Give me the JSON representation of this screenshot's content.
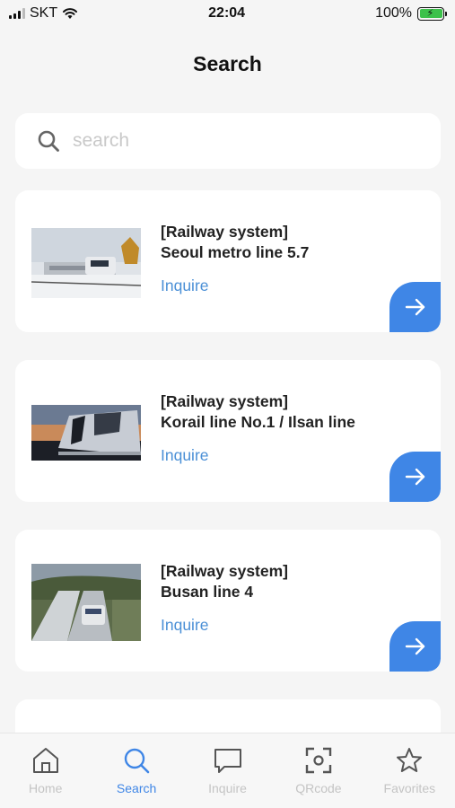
{
  "status_bar": {
    "carrier": "SKT",
    "time": "22:04",
    "battery": "100%"
  },
  "header": {
    "title": "Search"
  },
  "search": {
    "placeholder": "search",
    "value": ""
  },
  "cards": [
    {
      "tag": "[Railway system]",
      "name": "Seoul metro line 5.7",
      "action": "Inquire"
    },
    {
      "tag": "[Railway system]",
      "name": "Korail line No.1 / Ilsan line",
      "action": "Inquire"
    },
    {
      "tag": "[Railway system]",
      "name": "Busan line 4",
      "action": "Inquire"
    }
  ],
  "tab_bar": {
    "items": [
      {
        "label": "Home",
        "icon": "home-icon",
        "active": false
      },
      {
        "label": "Search",
        "icon": "search-icon",
        "active": true
      },
      {
        "label": "Inquire",
        "icon": "chat-bubble-icon",
        "active": false
      },
      {
        "label": "QRcode",
        "icon": "qr-scan-icon",
        "active": false
      },
      {
        "label": "Favorites",
        "icon": "star-icon",
        "active": false
      }
    ]
  },
  "colors": {
    "accent": "#3f86e6",
    "link": "#4a8fd6",
    "inactive_tab": "#c4c4c4",
    "background": "#f5f5f5"
  }
}
